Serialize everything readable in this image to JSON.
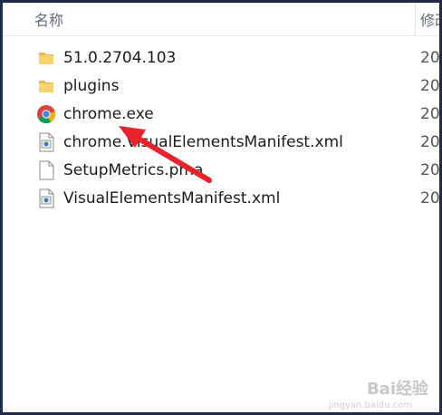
{
  "header": {
    "name_col": "名称",
    "modified_col": "修改"
  },
  "files": [
    {
      "name": "51.0.2704.103",
      "icon": "folder-icon",
      "date": "20"
    },
    {
      "name": "plugins",
      "icon": "folder-icon",
      "date": "20"
    },
    {
      "name": "chrome.exe",
      "icon": "chrome-icon",
      "date": "20"
    },
    {
      "name": "chrome.VisualElementsManifest.xml",
      "icon": "xml-file-icon",
      "date": "20"
    },
    {
      "name": "SetupMetrics.pma",
      "icon": "blank-file-icon",
      "date": "20"
    },
    {
      "name": "VisualElementsManifest.xml",
      "icon": "xml-file-icon",
      "date": "20"
    }
  ],
  "annotation": {
    "color": "#e8232a"
  },
  "watermark": {
    "text": "Bai经验",
    "sub": "jingyan.baidu.com"
  }
}
